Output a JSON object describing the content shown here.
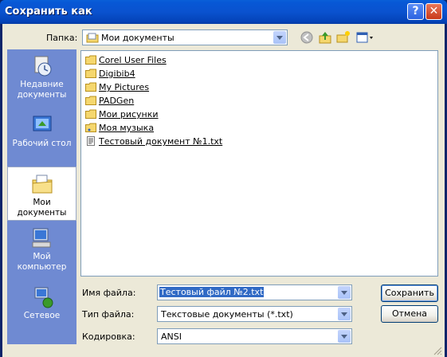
{
  "window": {
    "title": "Сохранить как",
    "help_label": "?",
    "close_label": "✕"
  },
  "toolbar": {
    "folder_label": "Папка:",
    "folder_value": "Мои документы",
    "icons": [
      "back-icon",
      "up-folder-icon",
      "new-folder-icon",
      "view-menu-icon"
    ]
  },
  "places": [
    {
      "label": "Недавние документы",
      "icon": "recent-documents-icon"
    },
    {
      "label": "Рабочий стол",
      "icon": "desktop-icon"
    },
    {
      "label": "Мои документы",
      "icon": "my-documents-icon",
      "active": true
    },
    {
      "label": "Мой компьютер",
      "icon": "my-computer-icon"
    },
    {
      "label": "Сетевое",
      "icon": "network-icon"
    }
  ],
  "files": [
    {
      "name": "Corel User Files",
      "type": "folder"
    },
    {
      "name": "Digibib4",
      "type": "folder"
    },
    {
      "name": "My Pictures",
      "type": "folder"
    },
    {
      "name": "PADGen",
      "type": "folder"
    },
    {
      "name": "Мои рисунки",
      "type": "folder"
    },
    {
      "name": "Моя музыка",
      "type": "folder"
    },
    {
      "name": "Тестовый документ №1.txt",
      "type": "file"
    }
  ],
  "form": {
    "filename_label": "Имя файла:",
    "filename_value": "Тестовый файл №2.txt",
    "filetype_label": "Тип файла:",
    "filetype_value": "Текстовые документы (*.txt)",
    "encoding_label": "Кодировка:",
    "encoding_value": "ANSI"
  },
  "buttons": {
    "save": "Сохранить",
    "cancel": "Отмена"
  },
  "colors": {
    "title_bar": "#0a5fd8",
    "places_bar": "#6f8ad2",
    "dialog_bg": "#ece9d8",
    "selection": "#316ac5"
  }
}
